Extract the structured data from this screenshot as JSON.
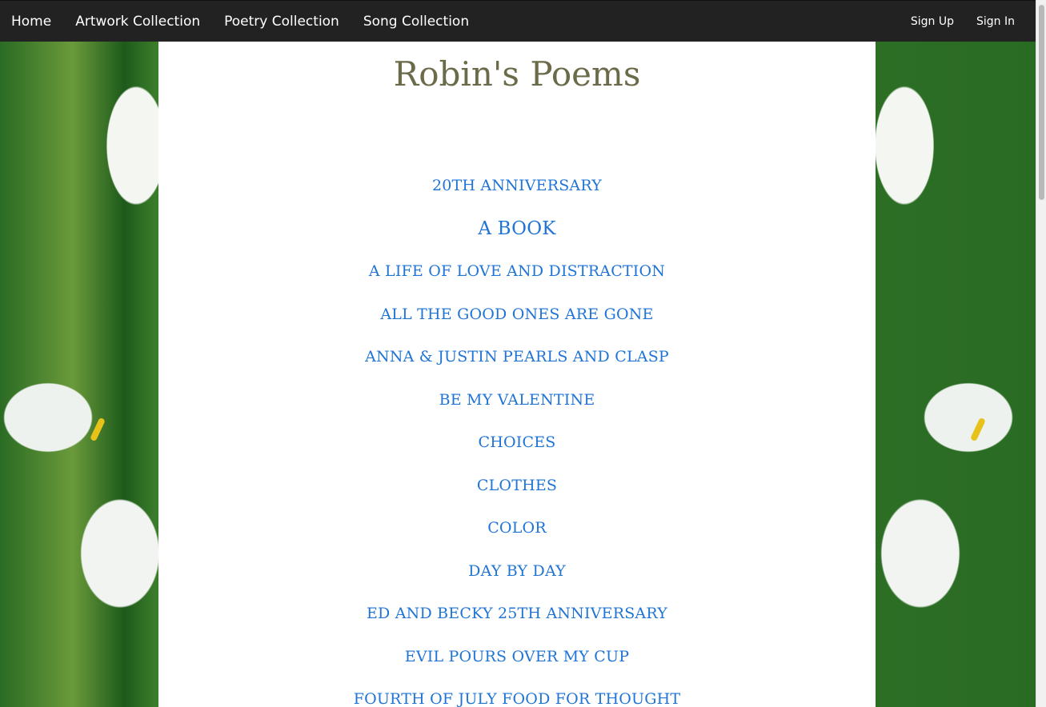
{
  "navbar": {
    "left": [
      {
        "label": "Home"
      },
      {
        "label": "Artwork Collection"
      },
      {
        "label": "Poetry Collection"
      },
      {
        "label": "Song Collection"
      }
    ],
    "right": [
      {
        "label": "Sign Up"
      },
      {
        "label": "Sign In"
      }
    ],
    "background": "#222222"
  },
  "page": {
    "title": "Robin's Poems",
    "title_color": "#6b6b4a",
    "link_color": "#1f74d6"
  },
  "poems": [
    {
      "title": "20TH ANNIVERSARY"
    },
    {
      "title": "A BOOK"
    },
    {
      "title": "A LIFE OF LOVE AND DISTRACTION"
    },
    {
      "title": "ALL THE GOOD ONES ARE GONE"
    },
    {
      "title": "ANNA & JUSTIN PEARLS AND CLASP"
    },
    {
      "title": "BE MY VALENTINE"
    },
    {
      "title": "CHOICES"
    },
    {
      "title": "CLOTHES"
    },
    {
      "title": "COLOR"
    },
    {
      "title": "DAY BY DAY"
    },
    {
      "title": "ED AND BECKY 25TH ANNIVERSARY"
    },
    {
      "title": "EVIL POURS OVER MY CUP"
    },
    {
      "title": "FOURTH OF JULY FOOD FOR THOUGHT"
    }
  ]
}
